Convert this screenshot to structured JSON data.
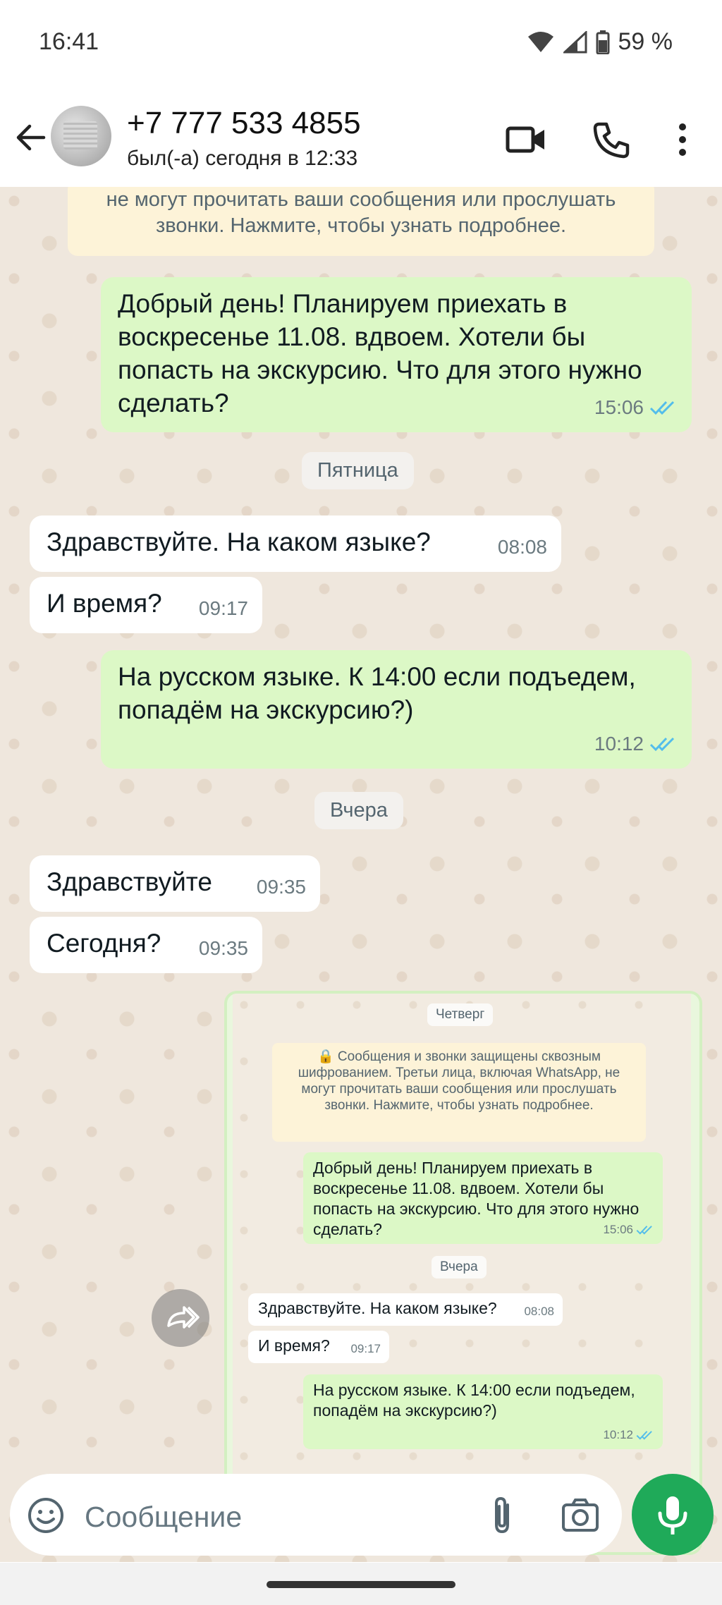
{
  "status_bar": {
    "time": "16:41",
    "battery": "59 %"
  },
  "header": {
    "contact_name": "+7 777 533 4855",
    "last_seen": "был(-а) сегодня в 12:33"
  },
  "chat": {
    "encryption_note": "не могут прочитать ваши сообщения или прослушать звонки. Нажмите, чтобы узнать подробнее.",
    "messages": [
      {
        "text": "Добрый день! Планируем приехать в воскресенье 11.08. вдвоем. Хотели бы попасть на экскурсию. Что для этого нужно сделать?",
        "time": "15:06",
        "direction": "out"
      },
      {
        "text": "Здравствуйте. На каком языке?",
        "time": "08:08",
        "direction": "in"
      },
      {
        "text": "И время?",
        "time": "09:17",
        "direction": "in"
      },
      {
        "text": "На русском языке. К 14:00 если подъедем, попадём на экскурсию?)",
        "time": "10:12",
        "direction": "out"
      },
      {
        "text": "Здравствуйте",
        "time": "09:35",
        "direction": "in"
      },
      {
        "text": "Сегодня?",
        "time": "09:35",
        "direction": "in"
      }
    ],
    "date_chips": [
      "Пятница",
      "Вчера"
    ]
  },
  "forwarded_screenshot": {
    "date_chip_1": "Четверг",
    "encryption_note": "🔒 Сообщения и звонки защищены сквозным шифрованием. Третьи лица, включая WhatsApp, не могут прочитать ваши сообщения или прослушать звонки. Нажмите, чтобы узнать подробнее.",
    "date_chip_2": "Вчера",
    "messages": [
      {
        "text": "Добрый день! Планируем приехать в воскресенье 11.08. вдвоем. Хотели бы попасть на экскурсию. Что для этого нужно сделать?",
        "time": "15:06"
      },
      {
        "text": "Здравствуйте. На каком языке?",
        "time": "08:08"
      },
      {
        "text": "И время?",
        "time": "09:17"
      },
      {
        "text": "На русском языке. К 14:00 если подъедем, попадём на экскурсию?)",
        "time": "10:12"
      }
    ]
  },
  "input": {
    "placeholder": "Сообщение"
  },
  "colors": {
    "outgoing": "#dcf8c6",
    "incoming": "#ffffff",
    "accent": "#1faa59",
    "read_ticks": "#53bdeb"
  },
  "icons": [
    "back-arrow-icon",
    "video-call-icon",
    "phone-icon",
    "more-vert-icon",
    "emoji-icon",
    "attach-icon",
    "camera-icon",
    "mic-icon",
    "forward-icon",
    "double-check-icon",
    "wifi-icon",
    "signal-icon",
    "battery-icon"
  ]
}
